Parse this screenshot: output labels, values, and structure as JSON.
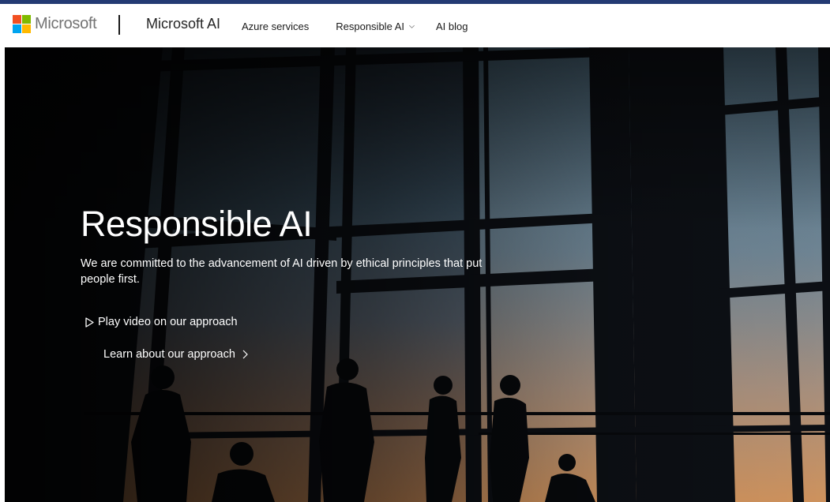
{
  "brand": {
    "name": "Microsoft",
    "colors": {
      "red": "#f25022",
      "green": "#7fba00",
      "blue": "#00a4ef",
      "yellow": "#ffb900"
    },
    "accent": "#243a73"
  },
  "header": {
    "site_title": "Microsoft AI",
    "nav": [
      {
        "label": "Azure services",
        "icon": null
      },
      {
        "label": "Responsible AI",
        "icon": "chevron-down-icon"
      },
      {
        "label": "AI blog",
        "icon": null
      }
    ]
  },
  "hero": {
    "title": "Responsible AI",
    "subtitle": "We are committed to the advancement of AI driven by ethical principles that put people first.",
    "play_video": {
      "label": "Play video on our approach",
      "icon": "play-icon"
    },
    "learn_more": {
      "label": "Learn about our approach",
      "icon": "chevron-right-icon"
    },
    "background": "silhouettes-at-window-sunset"
  }
}
